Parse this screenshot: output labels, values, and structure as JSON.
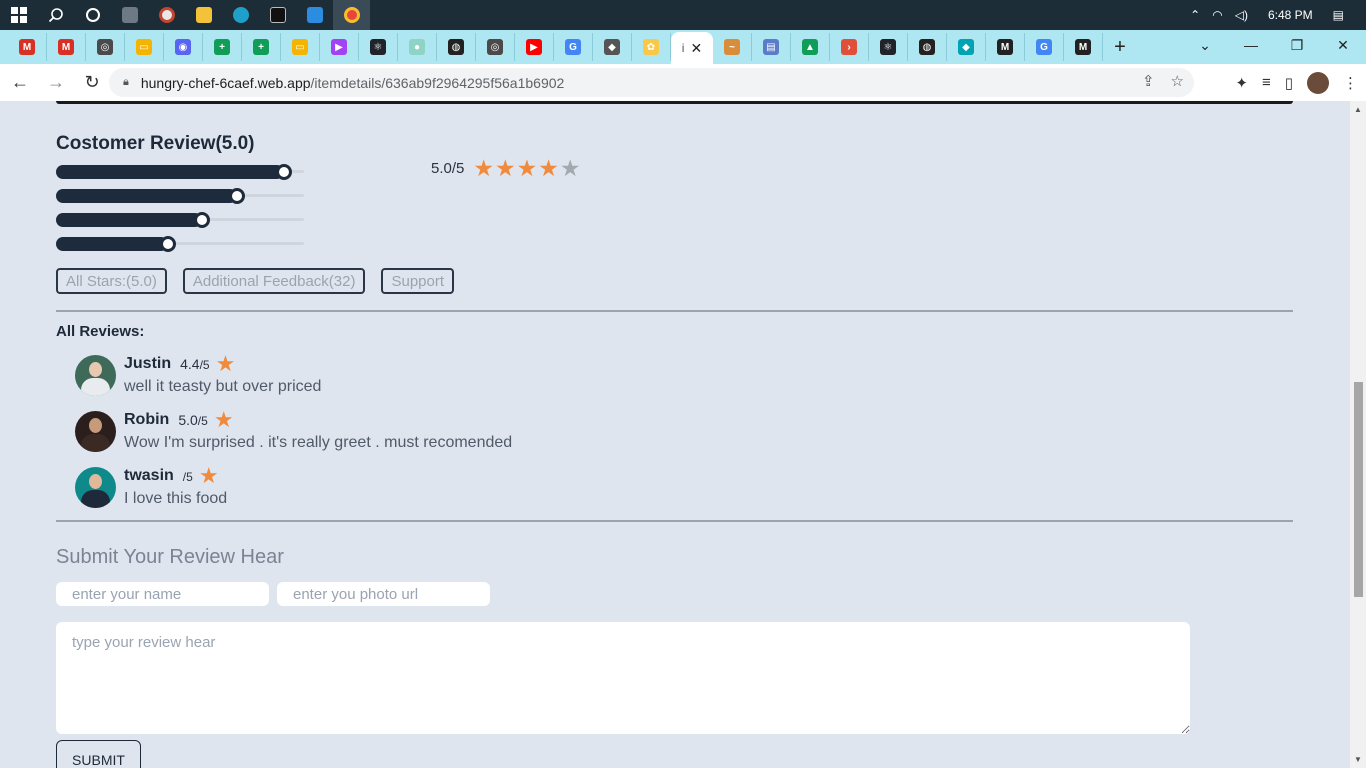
{
  "taskbar": {
    "time": "6:48 PM",
    "icons": [
      "windows-icon",
      "search-icon",
      "cortana-icon",
      "calculator-icon",
      "media-icon",
      "folder-icon",
      "edge-icon",
      "terminal-icon",
      "vscode-icon",
      "chrome-icon"
    ]
  },
  "tabs": [
    {
      "icon": "gmail-icon",
      "color": "#d93025",
      "glyph": "M"
    },
    {
      "icon": "gmail-icon",
      "color": "#d93025",
      "glyph": "M"
    },
    {
      "icon": "github-icon",
      "color": "#4a4a4a",
      "glyph": "◎"
    },
    {
      "icon": "slides-icon",
      "color": "#f4b400",
      "glyph": "▭"
    },
    {
      "icon": "discord-icon",
      "color": "#5865f2",
      "glyph": "◉"
    },
    {
      "icon": "sheets-icon",
      "color": "#0f9d58",
      "glyph": "+"
    },
    {
      "icon": "sheets-icon",
      "color": "#0f9d58",
      "glyph": "+"
    },
    {
      "icon": "slides-icon",
      "color": "#f4b400",
      "glyph": "▭"
    },
    {
      "icon": "app-icon",
      "color": "#a142f4",
      "glyph": "▶"
    },
    {
      "icon": "react-icon",
      "color": "#20232a",
      "glyph": "⚛"
    },
    {
      "icon": "app-icon",
      "color": "#8fd3c5",
      "glyph": "●"
    },
    {
      "icon": "globe-icon",
      "color": "#222222",
      "glyph": "◍"
    },
    {
      "icon": "github-icon",
      "color": "#4a4a4a",
      "glyph": "◎"
    },
    {
      "icon": "youtube-icon",
      "color": "#ff0000",
      "glyph": "▶"
    },
    {
      "icon": "google-icon",
      "color": "#4285f4",
      "glyph": "G"
    },
    {
      "icon": "app-icon",
      "color": "#555555",
      "glyph": "◆"
    },
    {
      "icon": "app-icon",
      "color": "#f9c846",
      "glyph": "✿"
    },
    {
      "icon": "app-icon",
      "color": "#d98c3a",
      "glyph": "~"
    },
    {
      "icon": "app-icon",
      "color": "#5b7cc9",
      "glyph": "▤"
    },
    {
      "icon": "drive-icon",
      "color": "#0f9d58",
      "glyph": "▲"
    },
    {
      "icon": "app-icon",
      "color": "#e04f39",
      "glyph": "›"
    },
    {
      "icon": "react-icon",
      "color": "#20232a",
      "glyph": "⚛"
    },
    {
      "icon": "globe-icon",
      "color": "#222222",
      "glyph": "◍"
    },
    {
      "icon": "app-icon",
      "color": "#00a3b4",
      "glyph": "◆"
    },
    {
      "icon": "app-icon",
      "color": "#222222",
      "glyph": "M"
    },
    {
      "icon": "google-icon",
      "color": "#4285f4",
      "glyph": "G"
    },
    {
      "icon": "app-icon",
      "color": "#222222",
      "glyph": "M"
    }
  ],
  "active_tab": {
    "glyph": "i",
    "close": "✕"
  },
  "address": {
    "host": "hungry-chef-6caef.web.app",
    "path": "/itemdetails/636ab9f2964295f56a1b6902"
  },
  "review": {
    "title": "Costomer Review(5.0)",
    "score_text": "5.0/5",
    "stars_filled": 4,
    "stars_total": 5,
    "bars": [
      0.92,
      0.73,
      0.59,
      0.45
    ],
    "filters": [
      "All Stars:(5.0)",
      "Additional Feedback(32)",
      "Support"
    ]
  },
  "all_reviews_label": "All Reviews:",
  "reviews": [
    {
      "name": "Justin",
      "rating": "4.4",
      "suffix": "/5",
      "text": "well it teasty but over priced",
      "avatar_bg": "#3f6a5a",
      "skin": "#e8c9b0",
      "shirt": "#e9ecef"
    },
    {
      "name": "Robin",
      "rating": "5.0",
      "suffix": "/5",
      "text": "Wow I'm surprised . it's really greet . must recomended",
      "avatar_bg": "#2a1f1c",
      "skin": "#c79a7a",
      "shirt": "#3b2a24"
    },
    {
      "name": "twasin",
      "rating": "",
      "suffix": "/5",
      "text": "I love this food",
      "avatar_bg": "#0f8a8a",
      "skin": "#e2b89a",
      "shirt": "#1e2a3a"
    }
  ],
  "submit": {
    "title": "Submit Your Review Hear",
    "name_placeholder": "enter your name",
    "photo_placeholder": "enter you photo url",
    "review_placeholder": "type your review hear",
    "button": "SUBMIT"
  },
  "colors": {
    "accent_star": "#f08a3c",
    "dark": "#1e2b3c",
    "page_bg": "#dfe5ee"
  }
}
